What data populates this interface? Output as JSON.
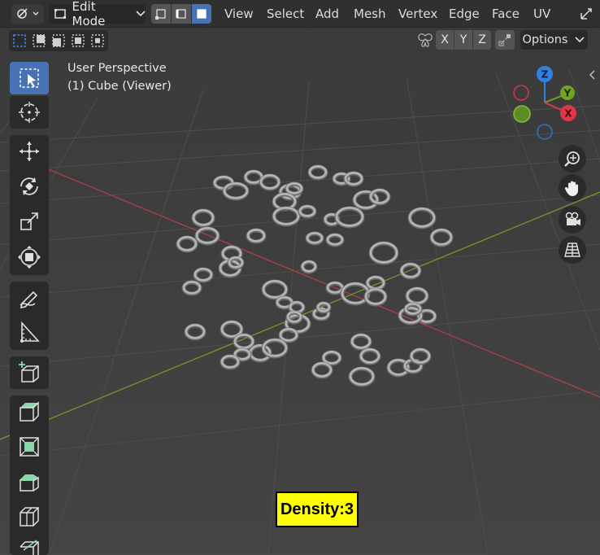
{
  "header": {
    "mode_label": "Edit Mode",
    "menus": [
      "View",
      "Select",
      "Add",
      "Mesh",
      "Vertex",
      "Edge",
      "Face",
      "UV"
    ]
  },
  "secondbar": {
    "axis_x": "X",
    "axis_y": "Y",
    "axis_z": "Z",
    "options_label": "Options"
  },
  "viewport": {
    "perspective_label": "User Perspective",
    "object_label": "(1) Cube (Viewer)",
    "density_label": "Density:3"
  },
  "gizmo": {
    "z": "Z",
    "y": "Y",
    "x": "X",
    "colors": {
      "z": "#2f83e0",
      "y": "#72a321",
      "x": "#e2354a"
    }
  },
  "toolbar_icons": [
    "select-box-icon",
    "cursor-icon",
    "move-icon",
    "rotate-icon",
    "scale-icon",
    "transform-icon",
    "annotate-icon",
    "measure-icon",
    "add-cube-icon",
    "extrude-icon",
    "inset-icon",
    "bevel-icon",
    "loop-cut-icon",
    "knife-icon"
  ],
  "nav_icons": [
    "zoom-icon",
    "pan-hand-icon",
    "camera-icon",
    "ortho-grid-icon"
  ]
}
